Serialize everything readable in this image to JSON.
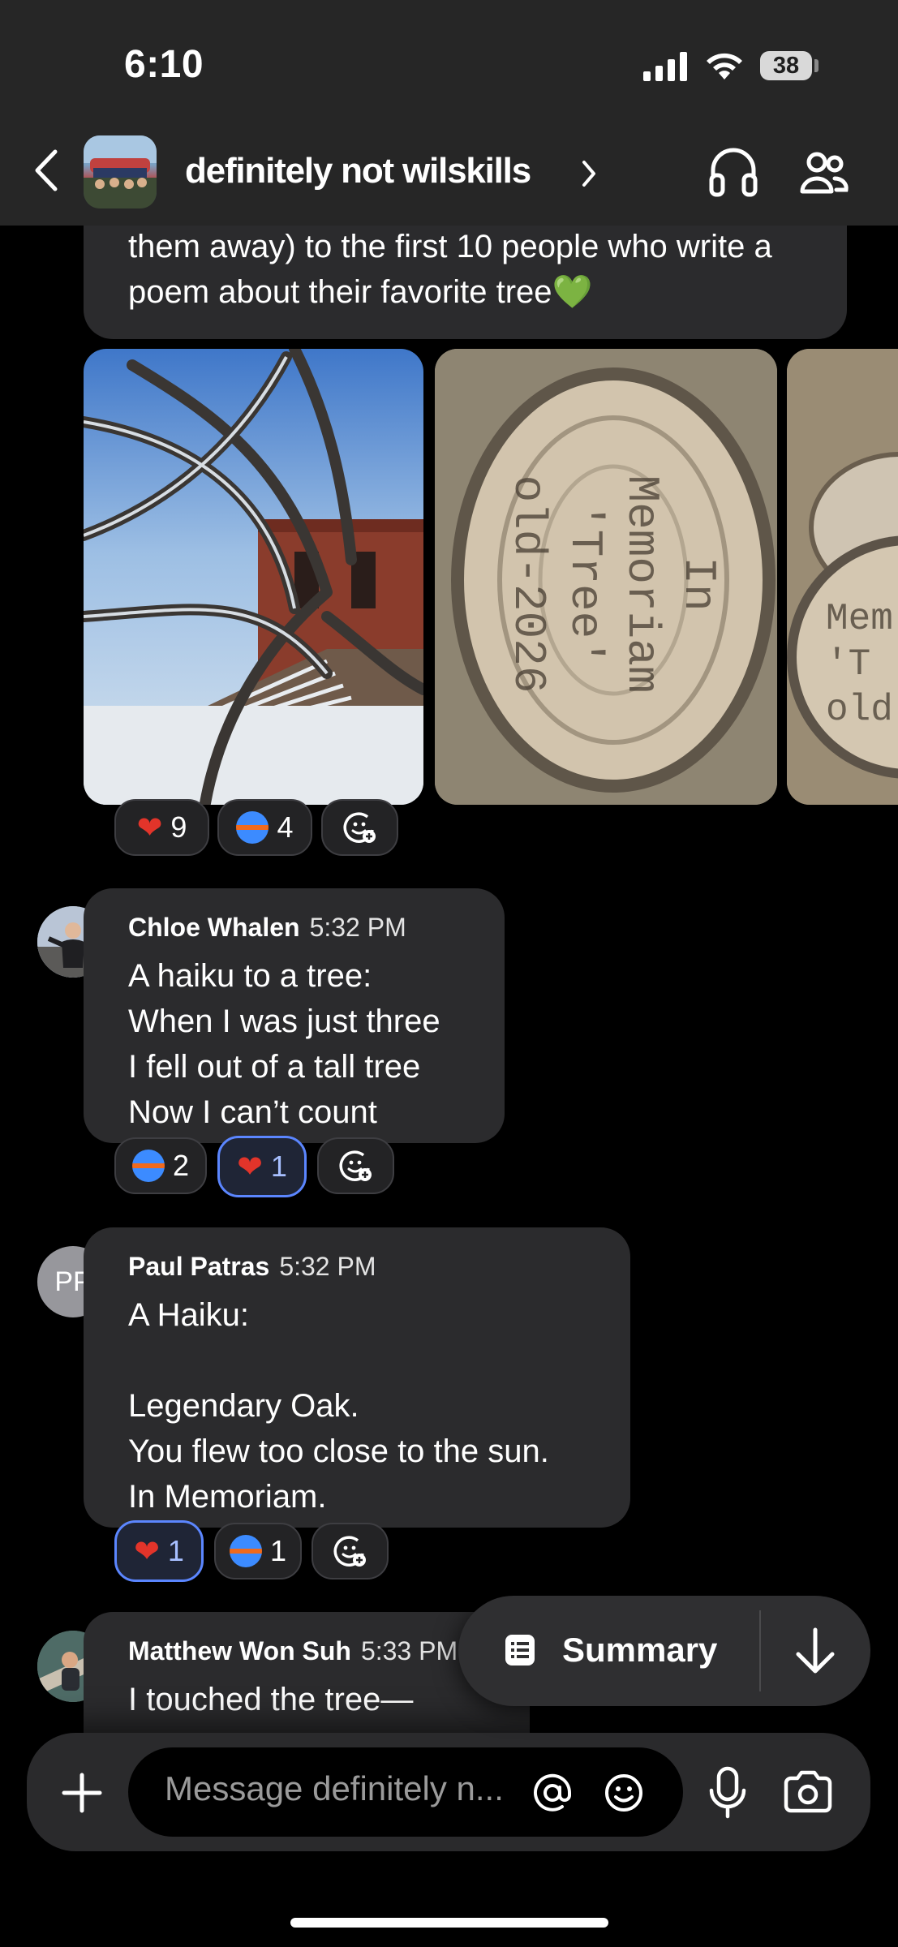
{
  "status_bar": {
    "time": "6:10",
    "battery": "38"
  },
  "header": {
    "title": "definitely not wilskills"
  },
  "prev_message": {
    "text_line1": "them away) to the first 10 people who write a",
    "text_line2": "poem about their favorite tree💚"
  },
  "photo_message": {
    "wood_text_1": "In\nMemoriam\n'Tree'\nold-2026",
    "wood_text_2": "Mem\n'T\nold-",
    "reactions": [
      {
        "icon": "heart",
        "count": "9"
      },
      {
        "icon": "swimsuit",
        "count": "4"
      }
    ]
  },
  "messages": [
    {
      "sender": "Chloe Whalen",
      "time": "5:32 PM",
      "text": "A haiku to a tree:\nWhen I was just three\nI fell out of a tall tree\nNow I can’t count",
      "reactions": [
        {
          "icon": "swimsuit",
          "count": "2"
        },
        {
          "icon": "heart",
          "count": "1"
        }
      ]
    },
    {
      "sender": "Paul Patras",
      "initials": "PP",
      "time": "5:32 PM",
      "text": "A Haiku:\n\nLegendary Oak.\nYou flew too close to the sun.\nIn Memoriam.",
      "reactions": [
        {
          "icon": "heart",
          "count": "1"
        },
        {
          "icon": "swimsuit",
          "count": "1"
        }
      ]
    },
    {
      "sender": "Matthew Won Suh",
      "time": "5:33 PM",
      "text": "I touched the tree—"
    }
  ],
  "summary_button": {
    "label": "Summary"
  },
  "composer": {
    "placeholder": "Message definitely n..."
  }
}
